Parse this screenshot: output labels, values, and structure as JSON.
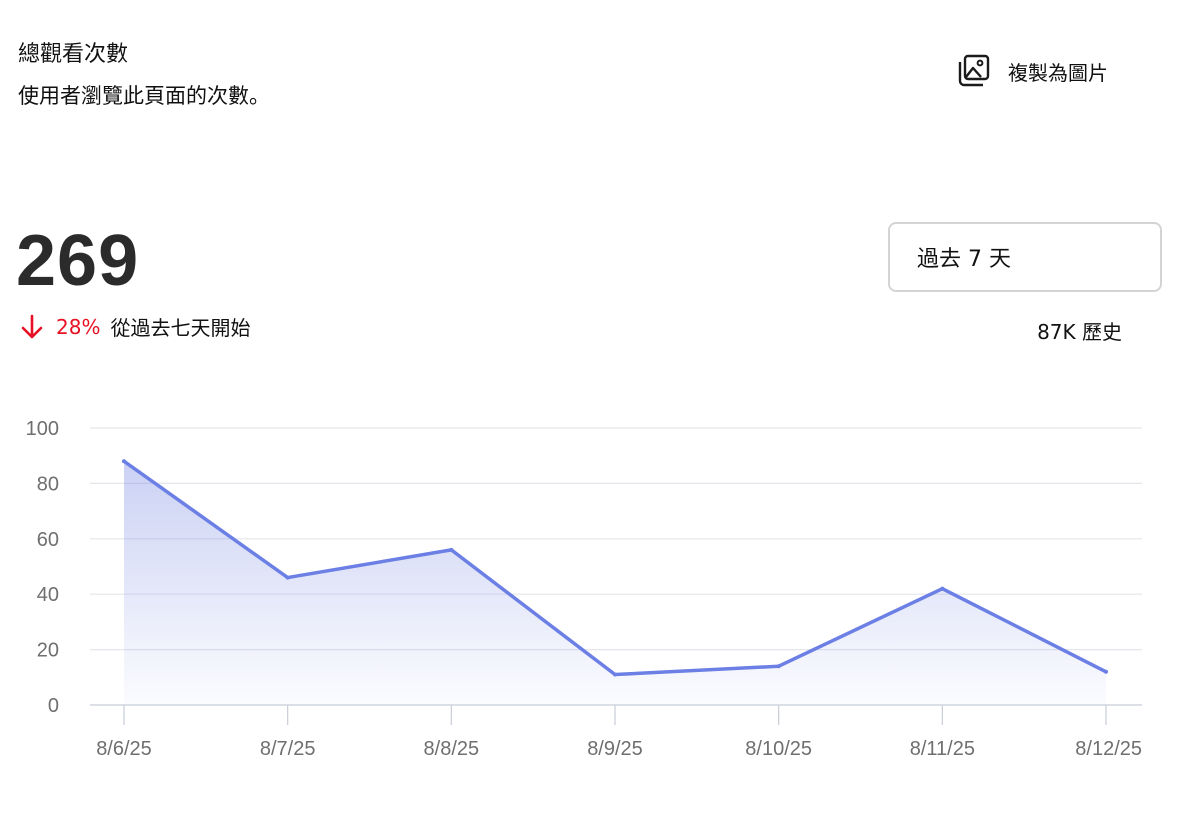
{
  "header": {
    "title": "總觀看次數",
    "subtitle": "使用者瀏覽此頁面的次數。",
    "copy_label": "複製為圖片",
    "copy_icon": "image-icon"
  },
  "summary": {
    "total": "269",
    "change_icon": "arrow-down-icon",
    "change_pct": "28%",
    "change_text": "從過去七天開始",
    "change_color": "#e81123"
  },
  "range": {
    "selected": "過去 7 天"
  },
  "history_text": "87K 歷史",
  "chart_data": {
    "type": "area",
    "x": [
      "8/6/25",
      "8/7/25",
      "8/8/25",
      "8/9/25",
      "8/10/25",
      "8/11/25",
      "8/12/25"
    ],
    "series": [
      {
        "values": [
          88,
          46,
          56,
          11,
          14,
          42,
          12
        ]
      }
    ],
    "ylim": [
      0,
      100
    ],
    "yticks": [
      0,
      20,
      40,
      60,
      80,
      100
    ],
    "grid": true,
    "line_color": "#6b7fe5",
    "fill_color": "#8b99e6"
  }
}
